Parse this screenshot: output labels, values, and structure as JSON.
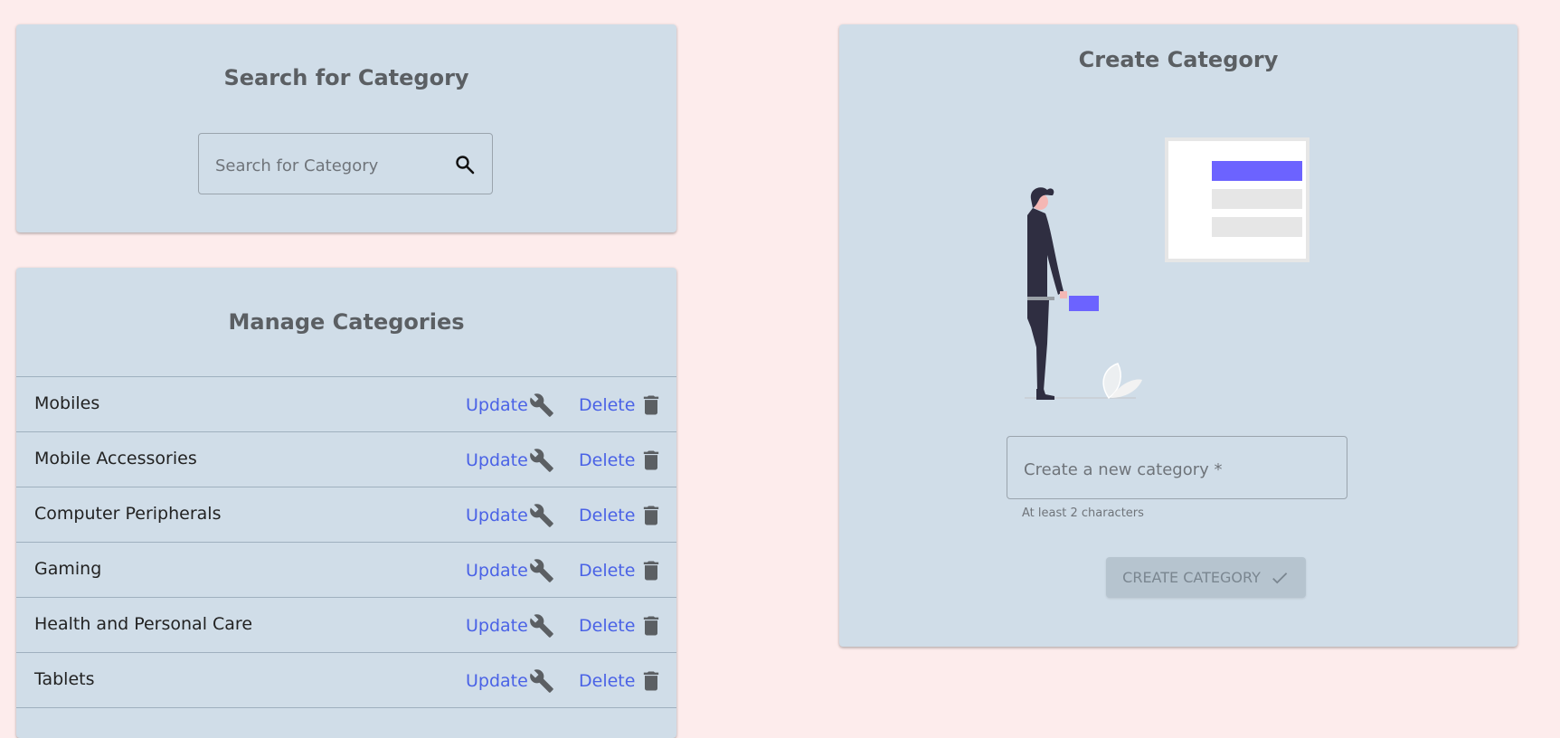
{
  "search_panel": {
    "title": "Search for Category",
    "input_placeholder": "Search for Category",
    "input_value": "",
    "icon": "search-icon"
  },
  "manage_panel": {
    "title": "Manage Categories",
    "update_label": "Update",
    "delete_label": "Delete",
    "update_icon": "wrench-icon",
    "delete_icon": "trash-icon",
    "categories": [
      {
        "name": "Mobiles"
      },
      {
        "name": "Mobile Accessories"
      },
      {
        "name": "Computer Peripherals"
      },
      {
        "name": "Gaming"
      },
      {
        "name": "Health and Personal Care"
      },
      {
        "name": "Tablets"
      }
    ]
  },
  "create_panel": {
    "title": "Create Category",
    "input_placeholder": "Create a new category *",
    "input_value": "",
    "helper_text": "At least 2 characters",
    "button_label": "Create Category",
    "button_icon": "check-icon",
    "button_disabled": true
  },
  "colors": {
    "page_background": "#fdecec",
    "panel_background": "#d0dde8",
    "link": "#4a62e6",
    "illustration_accent": "#6c63ff"
  }
}
